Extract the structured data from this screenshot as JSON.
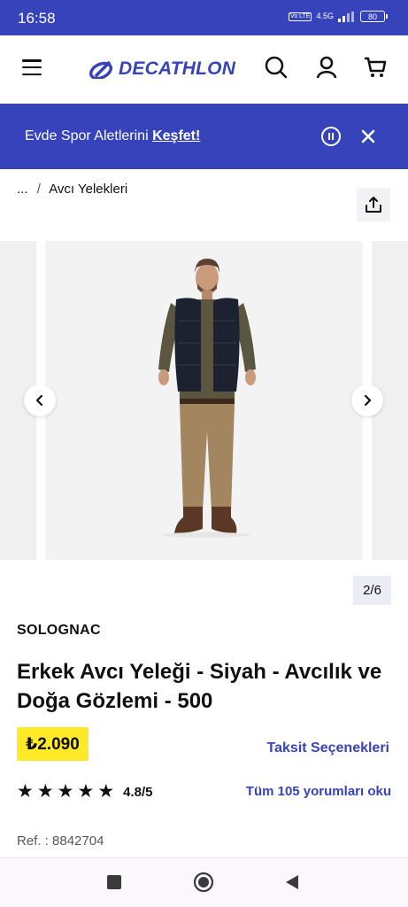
{
  "status_bar": {
    "time": "16:58",
    "volte": "Vo LTE",
    "network": "4.5G",
    "battery": "80"
  },
  "header": {
    "brand": "DECATHLON",
    "icons": [
      "menu-icon",
      "search-icon",
      "user-icon",
      "cart-icon"
    ]
  },
  "banner": {
    "text": "Evde Spor Aletlerini",
    "link": "Keşfet!"
  },
  "breadcrumb": {
    "ellipsis": "...",
    "separator": "/",
    "current": "Avcı Yelekleri"
  },
  "gallery": {
    "counter": "2/6"
  },
  "product": {
    "brand": "SOLOGNAC",
    "title": "Erkek Avcı Yeleği - Siyah - Avcılık ve Doğa Gözlemi - 500",
    "price": "₺2.090",
    "installment_label": "Taksit Seçenekleri",
    "rating": "4.8/5",
    "stars": 5,
    "reviews_link": "Tüm 105 yorumları oku",
    "ref": "Ref. : 8842704"
  },
  "colors": {
    "brand_blue": "#3643ba",
    "price_yellow": "#ffea28"
  }
}
